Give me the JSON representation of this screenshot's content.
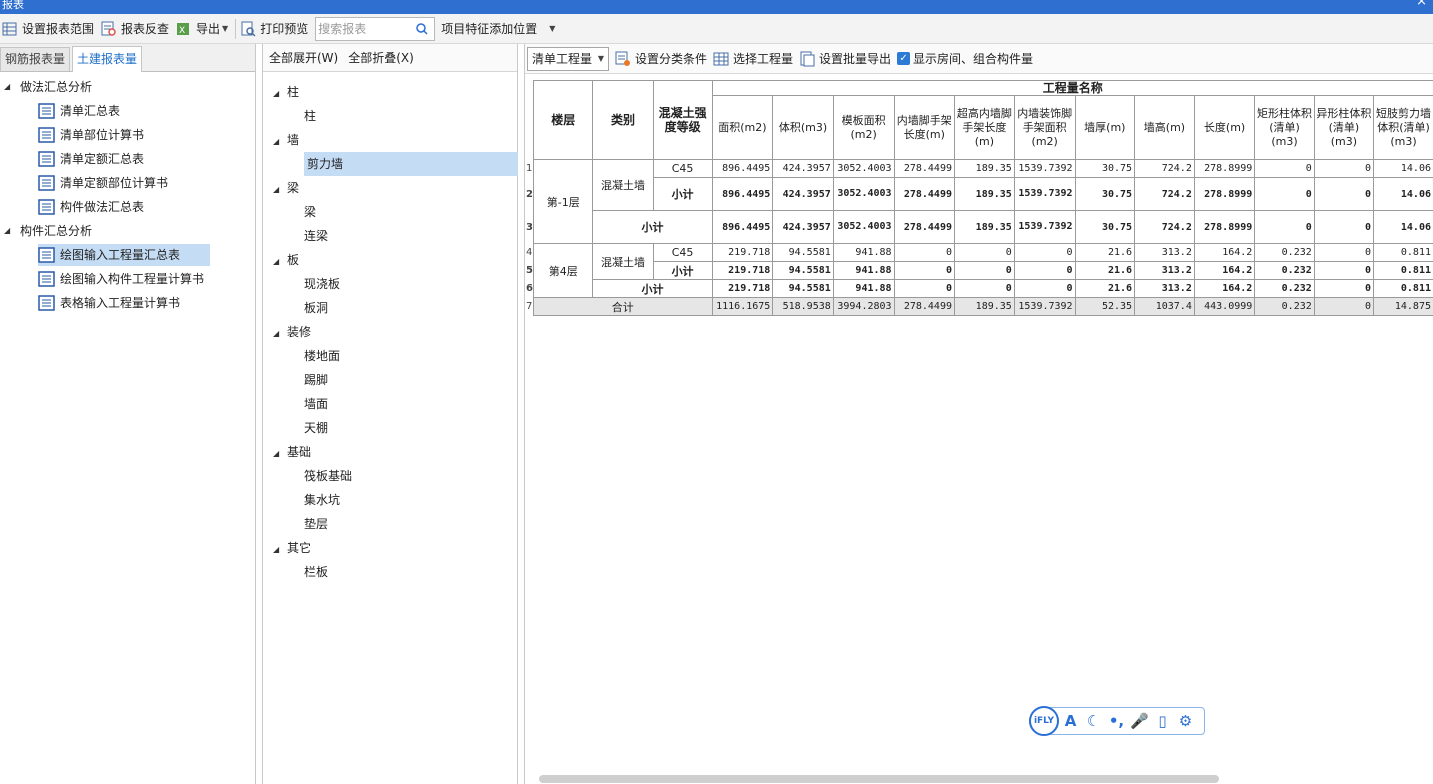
{
  "window": {
    "title": "报表",
    "close": "×"
  },
  "toolbar": {
    "set_range": "设置报表范围",
    "report_check": "报表反查",
    "export": "导出",
    "print_preview": "打印预览",
    "search_placeholder": "搜索报表",
    "add_position": "项目特征添加位置"
  },
  "left": {
    "tabs": [
      "钢筋报表量",
      "土建报表量"
    ],
    "groups": [
      {
        "label": "做法汇总分析",
        "items": [
          "清单汇总表",
          "清单部位计算书",
          "清单定额汇总表",
          "清单定额部位计算书",
          "构件做法汇总表"
        ]
      },
      {
        "label": "构件汇总分析",
        "items": [
          "绘图输入工程量汇总表",
          "绘图输入构件工程量计算书",
          "表格输入工程量计算书"
        ]
      }
    ]
  },
  "middle": {
    "expand_all": "全部展开(W)",
    "collapse_all": "全部折叠(X)",
    "categories": [
      {
        "label": "柱",
        "items": [
          "柱"
        ]
      },
      {
        "label": "墙",
        "items": [
          "剪力墙"
        ]
      },
      {
        "label": "梁",
        "items": [
          "梁",
          "连梁"
        ]
      },
      {
        "label": "板",
        "items": [
          "现浇板",
          "板洞"
        ]
      },
      {
        "label": "装修",
        "items": [
          "楼地面",
          "踢脚",
          "墙面",
          "天棚"
        ]
      },
      {
        "label": "基础",
        "items": [
          "筏板基础",
          "集水坑",
          "垫层"
        ]
      },
      {
        "label": "其它",
        "items": [
          "栏板"
        ]
      }
    ]
  },
  "right": {
    "select_value": "清单工程量",
    "set_category": "设置分类条件",
    "select_quantity": "选择工程量",
    "set_batch_export": "设置批量导出",
    "show_rooms": "显示房间、组合构件量",
    "show_rooms_checked": true
  },
  "table": {
    "group_header": "工程量名称",
    "fixed_headers": [
      "楼层",
      "类别",
      "混凝土强度等级"
    ],
    "columns": [
      "面积(m2)",
      "体积(m3)",
      "模板面积(m2)",
      "内墙脚手架长度(m)",
      "超高内墙脚手架长度(m)",
      "内墙装饰脚手架面积(m2)",
      "墙厚(m)",
      "墙高(m)",
      "长度(m)",
      "矩形柱体积(清单)(m3)",
      "异形柱体积(清单)(m3)",
      "短肢剪力墙体积(清单)(m3)"
    ],
    "rows": [
      {
        "n": "1",
        "floor": "第-1层",
        "type": "混凝土墙",
        "grade": "C45",
        "values": [
          "896.4495",
          "424.3957",
          "3052.4003",
          "278.4499",
          "189.35",
          "1539.7392",
          "30.75",
          "724.2",
          "278.8999",
          "0",
          "0",
          "14.06"
        ]
      },
      {
        "n": "2",
        "subtotal": "小计",
        "values": [
          "896.4495",
          "424.3957",
          "3052.4003",
          "278.4499",
          "189.35",
          "1539.7392",
          "30.75",
          "724.2",
          "278.8999",
          "0",
          "0",
          "14.06"
        ]
      },
      {
        "n": "3",
        "subtotal": "小计",
        "values": [
          "896.4495",
          "424.3957",
          "3052.4003",
          "278.4499",
          "189.35",
          "1539.7392",
          "30.75",
          "724.2",
          "278.8999",
          "0",
          "0",
          "14.06"
        ]
      },
      {
        "n": "4",
        "floor": "第4层",
        "type": "混凝土墙",
        "grade": "C45",
        "values": [
          "219.718",
          "94.5581",
          "941.88",
          "0",
          "0",
          "0",
          "21.6",
          "313.2",
          "164.2",
          "0.232",
          "0",
          "0.811"
        ]
      },
      {
        "n": "5",
        "subtotal": "小计",
        "values": [
          "219.718",
          "94.5581",
          "941.88",
          "0",
          "0",
          "0",
          "21.6",
          "313.2",
          "164.2",
          "0.232",
          "0",
          "0.811"
        ]
      },
      {
        "n": "6",
        "subtotal": "小计",
        "values": [
          "219.718",
          "94.5581",
          "941.88",
          "0",
          "0",
          "0",
          "21.6",
          "313.2",
          "164.2",
          "0.232",
          "0",
          "0.811"
        ]
      },
      {
        "n": "7",
        "total": "合计",
        "values": [
          "1116.1675",
          "518.9538",
          "3994.2803",
          "278.4499",
          "189.35",
          "1539.7392",
          "52.35",
          "1037.4",
          "443.0999",
          "0.232",
          "0",
          "14.875"
        ]
      }
    ]
  },
  "ime": {
    "brand": "iFLY",
    "items": [
      "A",
      "☾",
      "•,",
      "🎤",
      "▯",
      "⚙"
    ]
  },
  "colors": {
    "accent": "#2f6fcf",
    "selection": "#c5dcf5",
    "total_row": "#e6e6e6"
  }
}
